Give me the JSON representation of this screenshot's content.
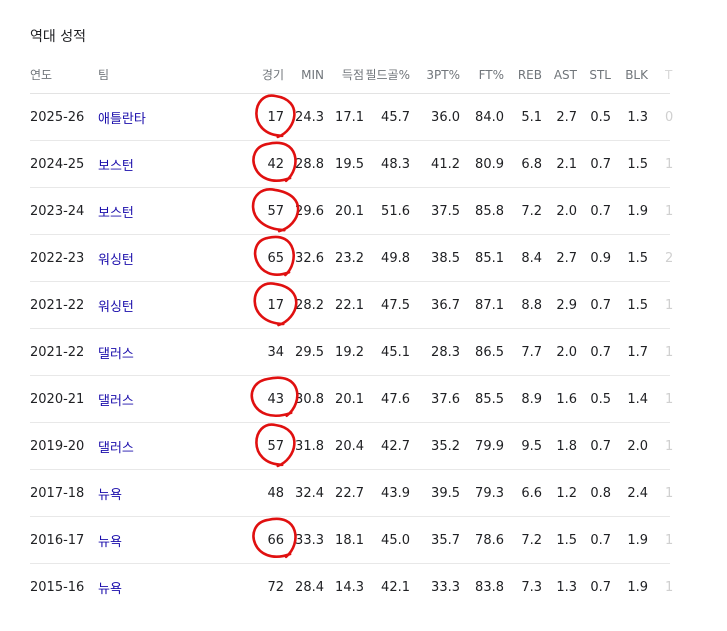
{
  "section_title": "역대 성적",
  "headers": [
    "연도",
    "팀",
    "경기",
    "MIN",
    "득점",
    "필드골%",
    "3PT%",
    "FT%",
    "REB",
    "AST",
    "STL",
    "BLK",
    "T"
  ],
  "rows": [
    {
      "year": "2025-26",
      "team": "애틀란타",
      "gp": "17",
      "min": "24.3",
      "pts": "17.1",
      "fg": "45.7",
      "tp": "36.0",
      "ft": "84.0",
      "reb": "5.1",
      "ast": "2.7",
      "stl": "0.5",
      "blk": "1.3",
      "to": "0"
    },
    {
      "year": "2024-25",
      "team": "보스턴",
      "gp": "42",
      "min": "28.8",
      "pts": "19.5",
      "fg": "48.3",
      "tp": "41.2",
      "ft": "80.9",
      "reb": "6.8",
      "ast": "2.1",
      "stl": "0.7",
      "blk": "1.5",
      "to": "1"
    },
    {
      "year": "2023-24",
      "team": "보스턴",
      "gp": "57",
      "min": "29.6",
      "pts": "20.1",
      "fg": "51.6",
      "tp": "37.5",
      "ft": "85.8",
      "reb": "7.2",
      "ast": "2.0",
      "stl": "0.7",
      "blk": "1.9",
      "to": "1"
    },
    {
      "year": "2022-23",
      "team": "워싱턴",
      "gp": "65",
      "min": "32.6",
      "pts": "23.2",
      "fg": "49.8",
      "tp": "38.5",
      "ft": "85.1",
      "reb": "8.4",
      "ast": "2.7",
      "stl": "0.9",
      "blk": "1.5",
      "to": "2"
    },
    {
      "year": "2021-22",
      "team": "워싱턴",
      "gp": "17",
      "min": "28.2",
      "pts": "22.1",
      "fg": "47.5",
      "tp": "36.7",
      "ft": "87.1",
      "reb": "8.8",
      "ast": "2.9",
      "stl": "0.7",
      "blk": "1.5",
      "to": "1"
    },
    {
      "year": "2021-22",
      "team": "댈러스",
      "gp": "34",
      "min": "29.5",
      "pts": "19.2",
      "fg": "45.1",
      "tp": "28.3",
      "ft": "86.5",
      "reb": "7.7",
      "ast": "2.0",
      "stl": "0.7",
      "blk": "1.7",
      "to": "1"
    },
    {
      "year": "2020-21",
      "team": "댈러스",
      "gp": "43",
      "min": "30.8",
      "pts": "20.1",
      "fg": "47.6",
      "tp": "37.6",
      "ft": "85.5",
      "reb": "8.9",
      "ast": "1.6",
      "stl": "0.5",
      "blk": "1.4",
      "to": "1"
    },
    {
      "year": "2019-20",
      "team": "댈러스",
      "gp": "57",
      "min": "31.8",
      "pts": "20.4",
      "fg": "42.7",
      "tp": "35.2",
      "ft": "79.9",
      "reb": "9.5",
      "ast": "1.8",
      "stl": "0.7",
      "blk": "2.0",
      "to": "1"
    },
    {
      "year": "2017-18",
      "team": "뉴욕",
      "gp": "48",
      "min": "32.4",
      "pts": "22.7",
      "fg": "43.9",
      "tp": "39.5",
      "ft": "79.3",
      "reb": "6.6",
      "ast": "1.2",
      "stl": "0.8",
      "blk": "2.4",
      "to": "1"
    },
    {
      "year": "2016-17",
      "team": "뉴욕",
      "gp": "66",
      "min": "33.3",
      "pts": "18.1",
      "fg": "45.0",
      "tp": "35.7",
      "ft": "78.6",
      "reb": "7.2",
      "ast": "1.5",
      "stl": "0.7",
      "blk": "1.9",
      "to": "1"
    },
    {
      "year": "2015-16",
      "team": "뉴욕",
      "gp": "72",
      "min": "28.4",
      "pts": "14.3",
      "fg": "42.1",
      "tp": "33.3",
      "ft": "83.8",
      "reb": "7.3",
      "ast": "1.3",
      "stl": "0.7",
      "blk": "1.9",
      "to": "1"
    }
  ],
  "circled_rows": [
    0,
    1,
    2,
    3,
    4,
    6,
    7,
    9
  ],
  "colors": {
    "team_link": "#1a0dab",
    "header_text": "#70757a",
    "annotation": "#e01010",
    "divider": "#e8e8e8"
  }
}
